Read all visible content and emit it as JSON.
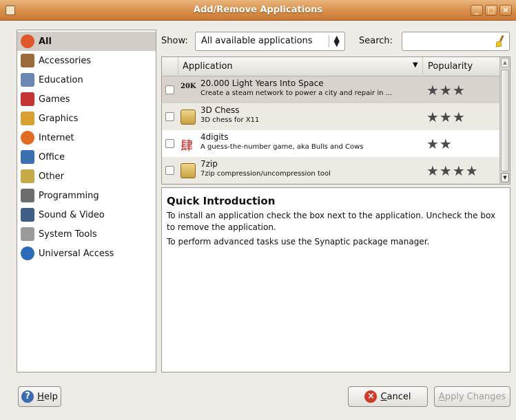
{
  "window": {
    "title": "Add/Remove Applications",
    "controls": [
      "_",
      "□",
      "×"
    ]
  },
  "sidebar": {
    "items": [
      {
        "label": "All",
        "icon": "ubuntu-logo-icon",
        "color": "#e0572b",
        "selected": true
      },
      {
        "label": "Accessories",
        "icon": "accessories-icon",
        "color": "#9a6a3a"
      },
      {
        "label": "Education",
        "icon": "education-icon",
        "color": "#6a87b4"
      },
      {
        "label": "Games",
        "icon": "games-icon",
        "color": "#c43535"
      },
      {
        "label": "Graphics",
        "icon": "graphics-icon",
        "color": "#d7a030"
      },
      {
        "label": "Internet",
        "icon": "internet-icon",
        "color": "#e26b24"
      },
      {
        "label": "Office",
        "icon": "office-icon",
        "color": "#3c6fb0"
      },
      {
        "label": "Other",
        "icon": "other-icon",
        "color": "#c7a84a"
      },
      {
        "label": "Programming",
        "icon": "programming-icon",
        "color": "#6d6d6d"
      },
      {
        "label": "Sound & Video",
        "icon": "sound-video-icon",
        "color": "#3e5e86"
      },
      {
        "label": "System Tools",
        "icon": "system-tools-icon",
        "color": "#9a9a9a"
      },
      {
        "label": "Universal Access",
        "icon": "universal-access-icon",
        "color": "#2e6bb8"
      }
    ]
  },
  "filter": {
    "show_label": "Show:",
    "show_value": "All available applications",
    "search_label": "Search:",
    "search_value": ""
  },
  "table": {
    "columns": {
      "application": "Application",
      "popularity": "Popularity"
    },
    "rows": [
      {
        "name": "20.000 Light Years Into Space",
        "desc": "Create a steam network to power a city and repair in ...",
        "icon": "20k-icon",
        "rating": 3,
        "stars": "★★★"
      },
      {
        "name": "3D Chess",
        "desc": "3D chess for X11",
        "icon": "package-icon",
        "rating": 3,
        "stars": "★★★"
      },
      {
        "name": "4digits",
        "desc": "A guess-the-number game, aka Bulls and Cows",
        "icon": "4digits-icon",
        "rating": 2,
        "stars": "★★"
      },
      {
        "name": "7zip",
        "desc": "7zip compression/uncompression tool",
        "icon": "package-icon",
        "rating": 4,
        "stars": "★★★★"
      }
    ]
  },
  "description": {
    "heading": "Quick Introduction",
    "para1": "To install an application check the box next to the application. Uncheck the box to remove the application.",
    "para2": "To perform advanced tasks use the Synaptic package manager."
  },
  "buttons": {
    "help_prefix": "",
    "help_mnemonic": "H",
    "help_rest": "elp",
    "cancel_mnemonic": "C",
    "cancel_rest": "ancel",
    "apply_mnemonic": "A",
    "apply_rest": "pply Changes"
  }
}
